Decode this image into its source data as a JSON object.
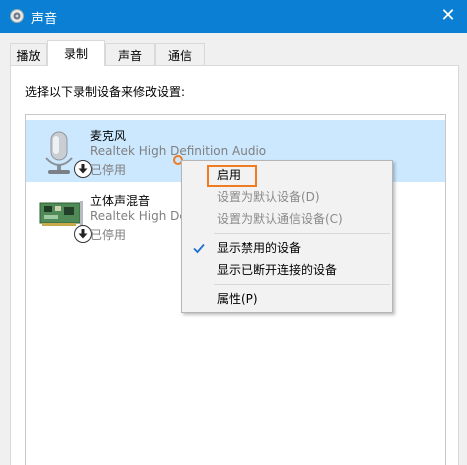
{
  "window": {
    "title": "声音",
    "close_glyph": "✕"
  },
  "tabs": [
    {
      "label": "播放"
    },
    {
      "label": "录制"
    },
    {
      "label": "声音"
    },
    {
      "label": "通信"
    }
  ],
  "panel": {
    "instruction": "选择以下录制设备来修改设置:"
  },
  "devices": [
    {
      "name": "麦克风",
      "description": "Realtek High Definition Audio",
      "status": "已停用",
      "icon": "microphone-icon",
      "selected": true
    },
    {
      "name": "立体声混音",
      "description": "Realtek High De",
      "status": "已停用",
      "icon": "sound-card-icon",
      "selected": false
    }
  ],
  "context_menu": {
    "items": [
      {
        "label": "启用",
        "enabled": true
      },
      {
        "label": "设置为默认设备(D)",
        "enabled": false
      },
      {
        "label": "设置为默认通信设备(C)",
        "enabled": false
      },
      {
        "label": "显示禁用的设备",
        "enabled": true,
        "checked": true
      },
      {
        "label": "显示已断开连接的设备",
        "enabled": true
      },
      {
        "label": "属性(P)",
        "enabled": true
      }
    ]
  },
  "colors": {
    "titlebar": "#0a7fd4",
    "selection": "#cce8ff",
    "highlight": "#ef7b22",
    "check": "#1f6fd0"
  }
}
